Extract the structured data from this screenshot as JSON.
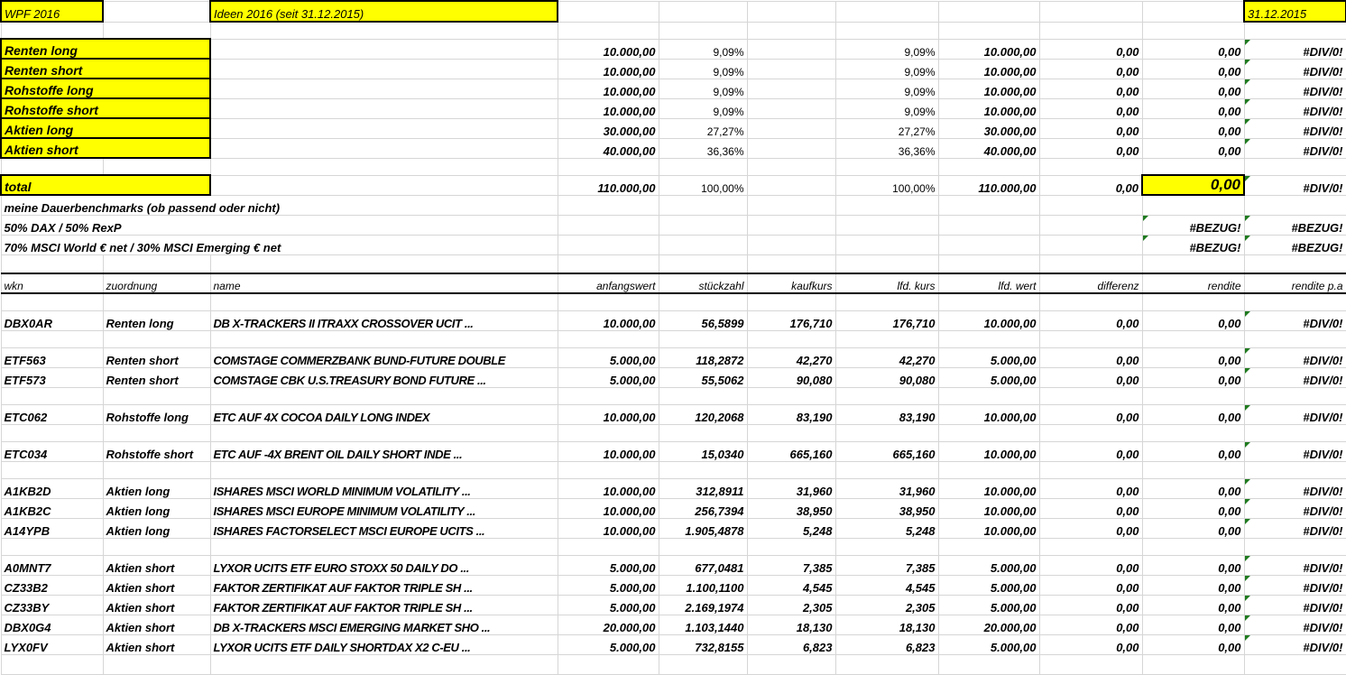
{
  "top": {
    "wpf": "WPF 2016",
    "ideen": "Ideen 2016 (seit 31.12.2015)",
    "date": "31.12.2015"
  },
  "summary": [
    {
      "label": "Renten long",
      "anfangswert": "10.000,00",
      "anteil": "9,09%",
      "anteil_lfd": "9,09%",
      "lfd_wert": "10.000,00",
      "differenz": "0,00",
      "rendite": "0,00",
      "rendite_pa": "#DIV/0!"
    },
    {
      "label": "Renten short",
      "anfangswert": "10.000,00",
      "anteil": "9,09%",
      "anteil_lfd": "9,09%",
      "lfd_wert": "10.000,00",
      "differenz": "0,00",
      "rendite": "0,00",
      "rendite_pa": "#DIV/0!"
    },
    {
      "label": "Rohstoffe long",
      "anfangswert": "10.000,00",
      "anteil": "9,09%",
      "anteil_lfd": "9,09%",
      "lfd_wert": "10.000,00",
      "differenz": "0,00",
      "rendite": "0,00",
      "rendite_pa": "#DIV/0!"
    },
    {
      "label": "Rohstoffe short",
      "anfangswert": "10.000,00",
      "anteil": "9,09%",
      "anteil_lfd": "9,09%",
      "lfd_wert": "10.000,00",
      "differenz": "0,00",
      "rendite": "0,00",
      "rendite_pa": "#DIV/0!"
    },
    {
      "label": "Aktien long",
      "anfangswert": "30.000,00",
      "anteil": "27,27%",
      "anteil_lfd": "27,27%",
      "lfd_wert": "30.000,00",
      "differenz": "0,00",
      "rendite": "0,00",
      "rendite_pa": "#DIV/0!"
    },
    {
      "label": "Aktien short",
      "anfangswert": "40.000,00",
      "anteil": "36,36%",
      "anteil_lfd": "36,36%",
      "lfd_wert": "40.000,00",
      "differenz": "0,00",
      "rendite": "0,00",
      "rendite_pa": "#DIV/0!"
    }
  ],
  "total": {
    "label": "total",
    "anfangswert": "110.000,00",
    "anteil": "100,00%",
    "anteil_lfd": "100,00%",
    "lfd_wert": "110.000,00",
    "differenz": "0,00",
    "rendite": "0,00",
    "rendite_pa": "#DIV/0!"
  },
  "benchmarks": {
    "title": "meine Dauerbenchmarks (ob passend oder nicht)",
    "rows": [
      {
        "label": "50% DAX / 50% RexP",
        "rendite": "#BEZUG!",
        "rendite_pa": "#BEZUG!"
      },
      {
        "label": "70% MSCI World € net / 30% MSCI Emerging € net",
        "rendite": "#BEZUG!",
        "rendite_pa": "#BEZUG!"
      }
    ]
  },
  "columns": [
    "wkn",
    "zuordnung",
    "name",
    "anfangswert",
    "stückzahl",
    "kaufkurs",
    "lfd. kurs",
    "lfd. wert",
    "differenz",
    "rendite",
    "rendite p.a"
  ],
  "groups": [
    [
      [
        "DBX0AR",
        "Renten long",
        "DB X-TRACKERS II ITRAXX CROSSOVER UCIT ...",
        "10.000,00",
        "56,5899",
        "176,710",
        "176,710",
        "10.000,00",
        "0,00",
        "0,00",
        "#DIV/0!"
      ]
    ],
    [
      [
        "ETF563",
        "Renten short",
        "COMSTAGE COMMERZBANK BUND-FUTURE DOUBLE",
        "5.000,00",
        "118,2872",
        "42,270",
        "42,270",
        "5.000,00",
        "0,00",
        "0,00",
        "#DIV/0!"
      ],
      [
        "ETF573",
        "Renten short",
        "COMSTAGE CBK U.S.TREASURY BOND FUTURE ...",
        "5.000,00",
        "55,5062",
        "90,080",
        "90,080",
        "5.000,00",
        "0,00",
        "0,00",
        "#DIV/0!"
      ]
    ],
    [
      [
        "ETC062",
        "Rohstoffe long",
        "ETC AUF 4X COCOA DAILY LONG INDEX",
        "10.000,00",
        "120,2068",
        "83,190",
        "83,190",
        "10.000,00",
        "0,00",
        "0,00",
        "#DIV/0!"
      ]
    ],
    [
      [
        "ETC034",
        "Rohstoffe short",
        "ETC AUF -4X BRENT OIL DAILY SHORT INDE ...",
        "10.000,00",
        "15,0340",
        "665,160",
        "665,160",
        "10.000,00",
        "0,00",
        "0,00",
        "#DIV/0!"
      ]
    ],
    [
      [
        "A1KB2D",
        "Aktien long",
        "ISHARES MSCI WORLD MINIMUM VOLATILITY ...",
        "10.000,00",
        "312,8911",
        "31,960",
        "31,960",
        "10.000,00",
        "0,00",
        "0,00",
        "#DIV/0!"
      ],
      [
        "A1KB2C",
        "Aktien long",
        "ISHARES MSCI EUROPE MINIMUM VOLATILITY ...",
        "10.000,00",
        "256,7394",
        "38,950",
        "38,950",
        "10.000,00",
        "0,00",
        "0,00",
        "#DIV/0!"
      ],
      [
        "A14YPB",
        "Aktien long",
        "ISHARES FACTORSELECT MSCI EUROPE UCITS ...",
        "10.000,00",
        "1.905,4878",
        "5,248",
        "5,248",
        "10.000,00",
        "0,00",
        "0,00",
        "#DIV/0!"
      ]
    ],
    [
      [
        "A0MNT7",
        "Aktien short",
        "LYXOR UCITS ETF EURO STOXX 50 DAILY DO ...",
        "5.000,00",
        "677,0481",
        "7,385",
        "7,385",
        "5.000,00",
        "0,00",
        "0,00",
        "#DIV/0!"
      ],
      [
        "CZ33B2",
        "Aktien short",
        "FAKTOR ZERTIFIKAT AUF FAKTOR TRIPLE SH ...",
        "5.000,00",
        "1.100,1100",
        "4,545",
        "4,545",
        "5.000,00",
        "0,00",
        "0,00",
        "#DIV/0!"
      ],
      [
        "CZ33BY",
        "Aktien short",
        "FAKTOR ZERTIFIKAT AUF FAKTOR TRIPLE SH ...",
        "5.000,00",
        "2.169,1974",
        "2,305",
        "2,305",
        "5.000,00",
        "0,00",
        "0,00",
        "#DIV/0!"
      ],
      [
        "DBX0G4",
        "Aktien short",
        "DB X-TRACKERS MSCI EMERGING MARKET SHO ...",
        "20.000,00",
        "1.103,1440",
        "18,130",
        "18,130",
        "20.000,00",
        "0,00",
        "0,00",
        "#DIV/0!"
      ],
      [
        "LYX0FV",
        "Aktien short",
        "LYXOR UCITS ETF DAILY SHORTDAX X2 C-EU ...",
        "5.000,00",
        "732,8155",
        "6,823",
        "6,823",
        "5.000,00",
        "0,00",
        "0,00",
        "#DIV/0!"
      ]
    ]
  ]
}
